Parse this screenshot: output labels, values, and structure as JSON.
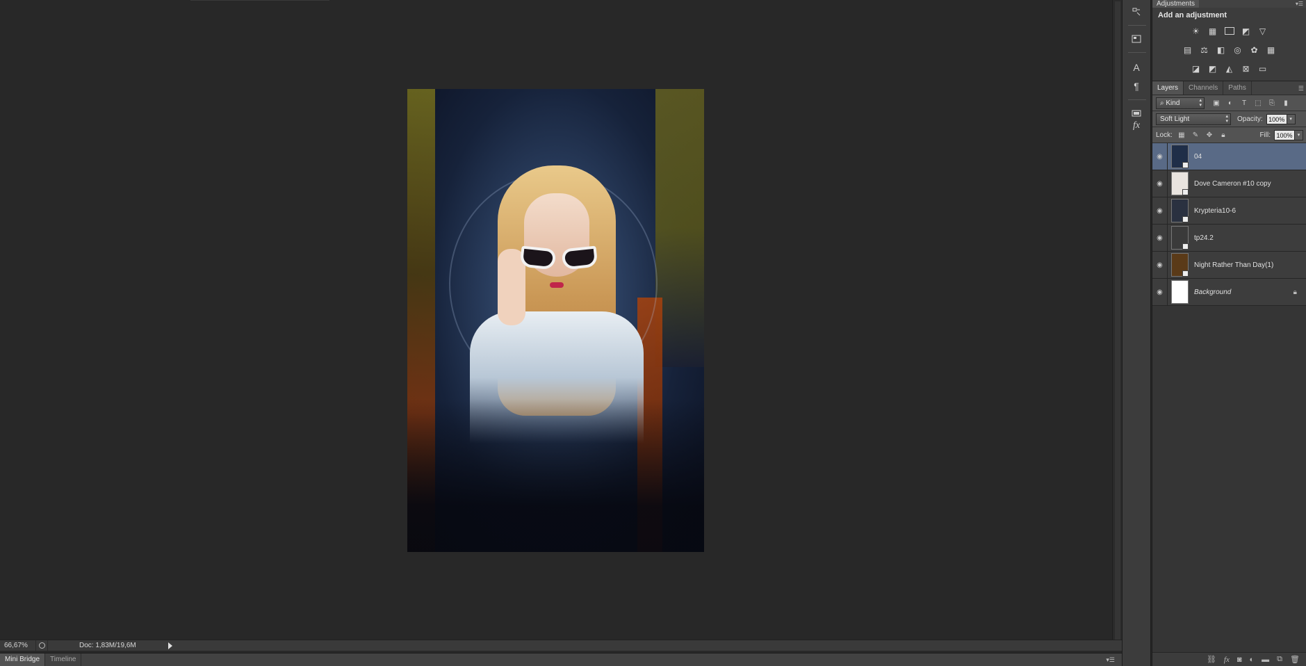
{
  "status": {
    "zoom": "66,67%",
    "doc_info": "Doc: 1,83M/19,6M"
  },
  "bottom_tabs": [
    {
      "label": "Mini Bridge",
      "active": true
    },
    {
      "label": "Timeline",
      "active": false
    }
  ],
  "toolstrip": {
    "icons": [
      "history-icon",
      "properties-icon",
      "character-icon",
      "paragraph-icon",
      "styles-icon",
      "fx-icon"
    ]
  },
  "adjustments": {
    "tab_label": "Adjustments",
    "title": "Add an adjustment",
    "row1": [
      "brightness-contrast-icon",
      "levels-icon",
      "curves-icon",
      "exposure-icon",
      "vibrance-icon"
    ],
    "row2": [
      "hue-saturation-icon",
      "color-balance-icon",
      "black-white-icon",
      "photo-filter-icon",
      "channel-mixer-icon",
      "color-lookup-icon"
    ],
    "row3": [
      "invert-icon",
      "posterize-icon",
      "threshold-icon",
      "selective-color-icon",
      "gradient-map-icon"
    ]
  },
  "layers_panel": {
    "tabs": [
      {
        "label": "Layers",
        "active": true
      },
      {
        "label": "Channels",
        "active": false
      },
      {
        "label": "Paths",
        "active": false
      }
    ],
    "filter_label": "Kind",
    "blend_mode": "Soft Light",
    "opacity_label": "Opacity:",
    "opacity_value": "100%",
    "lock_label": "Lock:",
    "fill_label": "Fill:",
    "fill_value": "100%",
    "layers": [
      {
        "name": "04",
        "selected": true,
        "thumb": "#1f2e48",
        "italic": false,
        "locked": false
      },
      {
        "name": "Dove Cameron #10 copy",
        "selected": false,
        "thumb": "#e9e4df",
        "italic": false,
        "locked": false
      },
      {
        "name": "Krypteria10-6",
        "selected": false,
        "thumb": "#2a3140",
        "italic": false,
        "locked": false
      },
      {
        "name": "tp24.2",
        "selected": false,
        "thumb": "#3a3a3a",
        "italic": false,
        "locked": false
      },
      {
        "name": "Night Rather Than Day(1)",
        "selected": false,
        "thumb": "#5a3a18",
        "italic": false,
        "locked": false
      },
      {
        "name": "Background",
        "selected": false,
        "thumb": "#ffffff",
        "italic": true,
        "locked": true
      }
    ]
  },
  "colors": {
    "selection": "#596a86",
    "panel_bg": "#3c3c3c",
    "canvas_bg": "#282828"
  }
}
